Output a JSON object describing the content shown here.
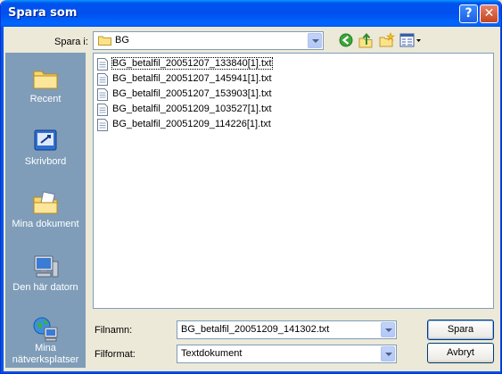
{
  "window": {
    "title": "Spara som"
  },
  "titlebar": {
    "help_glyph": "?",
    "close_glyph": "✕"
  },
  "lookin": {
    "label": "Spara i:",
    "value": "BG"
  },
  "places": [
    {
      "label": "Recent",
      "icon": "recent-folder-icon"
    },
    {
      "label": "Skrivbord",
      "icon": "desktop-icon"
    },
    {
      "label": "Mina dokument",
      "icon": "my-documents-icon"
    },
    {
      "label": "Den här datorn",
      "icon": "my-computer-icon"
    },
    {
      "label": "Mina nätverksplatser",
      "icon": "network-places-icon"
    }
  ],
  "files": [
    "BG_betalfil_20051207_133840[1].txt",
    "BG_betalfil_20051207_145941[1].txt",
    "BG_betalfil_20051207_153903[1].txt",
    "BG_betalfil_20051209_103527[1].txt",
    "BG_betalfil_20051209_114226[1].txt"
  ],
  "filename": {
    "label": "Filnamn:",
    "value": "BG_betalfil_20051209_141302.txt"
  },
  "filetype": {
    "label": "Filformat:",
    "value": "Textdokument"
  },
  "buttons": {
    "save": "Spara",
    "cancel": "Avbryt"
  },
  "colors": {
    "titlebar": "#0054e3",
    "places_bg": "#7f9db9",
    "dialog_bg": "#ece9d8"
  }
}
